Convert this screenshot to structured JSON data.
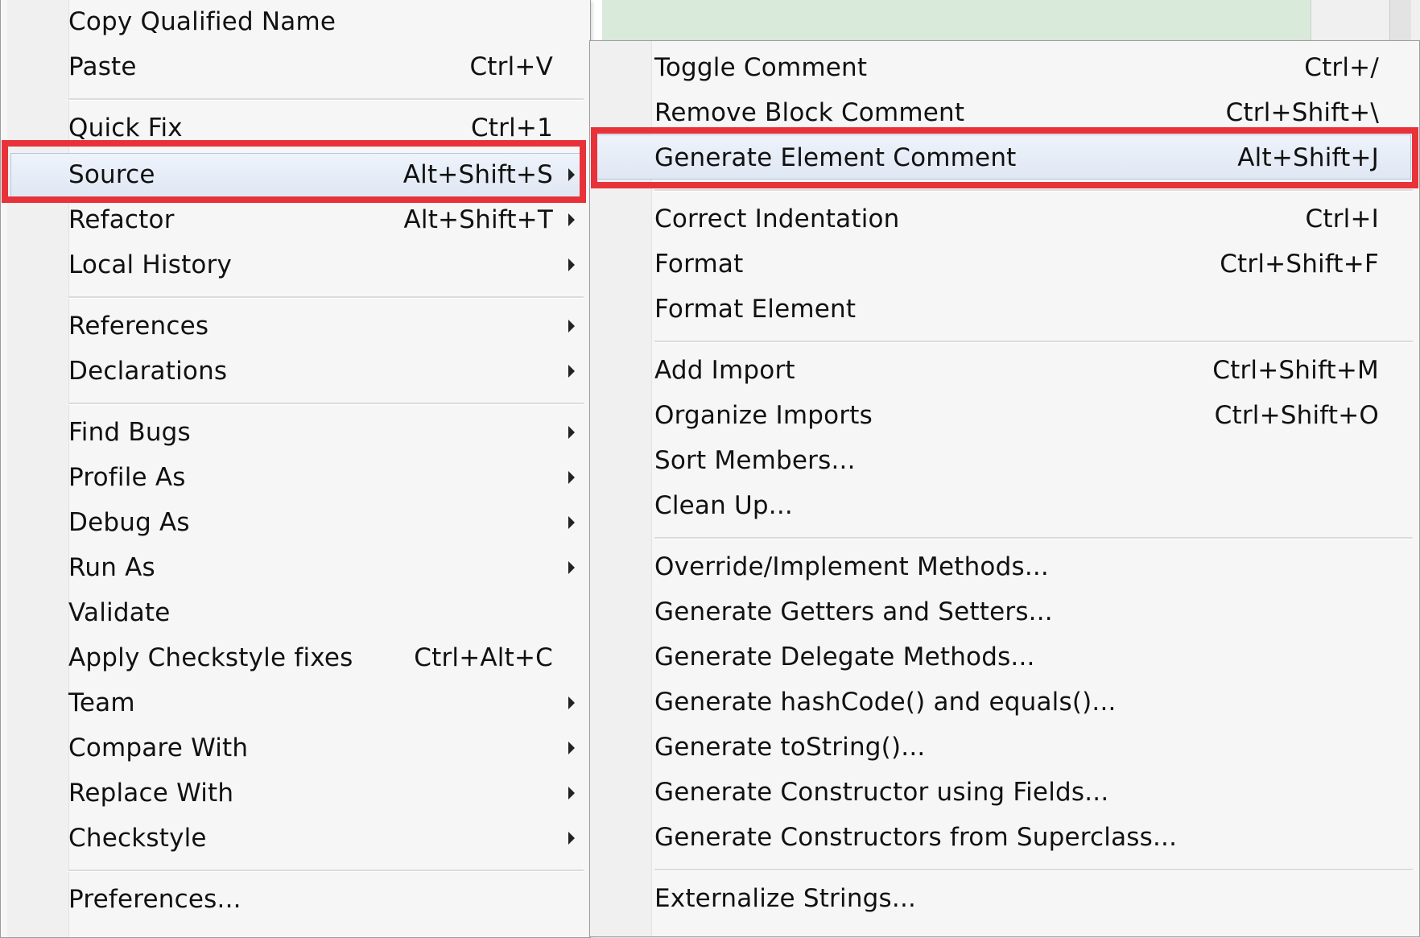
{
  "accent_colors": {
    "highlight_box": "#e8323a",
    "hover_bg": "#dfe7f3",
    "editor_bg": "#d9eadb"
  },
  "primary_menu": {
    "items": [
      {
        "label": "Copy Qualified Name",
        "shortcut": "",
        "submenu": false
      },
      {
        "label": "Paste",
        "shortcut": "Ctrl+V",
        "submenu": false
      },
      {
        "label": "Quick Fix",
        "shortcut": "Ctrl+1",
        "submenu": false
      },
      {
        "label": "Source",
        "shortcut": "Alt+Shift+S",
        "submenu": true
      },
      {
        "label": "Refactor",
        "shortcut": "Alt+Shift+T",
        "submenu": true
      },
      {
        "label": "Local History",
        "shortcut": "",
        "submenu": true
      },
      {
        "label": "References",
        "shortcut": "",
        "submenu": true
      },
      {
        "label": "Declarations",
        "shortcut": "",
        "submenu": true
      },
      {
        "label": "Find Bugs",
        "shortcut": "",
        "submenu": true
      },
      {
        "label": "Profile As",
        "shortcut": "",
        "submenu": true
      },
      {
        "label": "Debug As",
        "shortcut": "",
        "submenu": true
      },
      {
        "label": "Run As",
        "shortcut": "",
        "submenu": true
      },
      {
        "label": "Validate",
        "shortcut": "",
        "submenu": false
      },
      {
        "label": "Apply Checkstyle fixes",
        "shortcut": "Ctrl+Alt+C",
        "submenu": false
      },
      {
        "label": "Team",
        "shortcut": "",
        "submenu": true
      },
      {
        "label": "Compare With",
        "shortcut": "",
        "submenu": true
      },
      {
        "label": "Replace With",
        "shortcut": "",
        "submenu": true
      },
      {
        "label": "Checkstyle",
        "shortcut": "",
        "submenu": true
      },
      {
        "label": "Preferences...",
        "shortcut": "",
        "submenu": false
      }
    ],
    "highlighted": "Source"
  },
  "source_submenu": {
    "items": [
      {
        "label": "Toggle Comment",
        "shortcut": "Ctrl+/"
      },
      {
        "label": "Remove Block Comment",
        "shortcut": "Ctrl+Shift+\\"
      },
      {
        "label": "Generate Element Comment",
        "shortcut": "Alt+Shift+J"
      },
      {
        "label": "Correct Indentation",
        "shortcut": "Ctrl+I"
      },
      {
        "label": "Format",
        "shortcut": "Ctrl+Shift+F"
      },
      {
        "label": "Format Element",
        "shortcut": ""
      },
      {
        "label": "Add Import",
        "shortcut": "Ctrl+Shift+M"
      },
      {
        "label": "Organize Imports",
        "shortcut": "Ctrl+Shift+O"
      },
      {
        "label": "Sort Members...",
        "shortcut": ""
      },
      {
        "label": "Clean Up...",
        "shortcut": ""
      },
      {
        "label": "Override/Implement Methods...",
        "shortcut": ""
      },
      {
        "label": "Generate Getters and Setters...",
        "shortcut": ""
      },
      {
        "label": "Generate Delegate Methods...",
        "shortcut": ""
      },
      {
        "label": "Generate hashCode() and equals()...",
        "shortcut": ""
      },
      {
        "label": "Generate toString()...",
        "shortcut": ""
      },
      {
        "label": "Generate Constructor using Fields...",
        "shortcut": ""
      },
      {
        "label": "Generate Constructors from Superclass...",
        "shortcut": ""
      },
      {
        "label": "Externalize Strings...",
        "shortcut": ""
      }
    ],
    "highlighted": "Generate Element Comment"
  }
}
